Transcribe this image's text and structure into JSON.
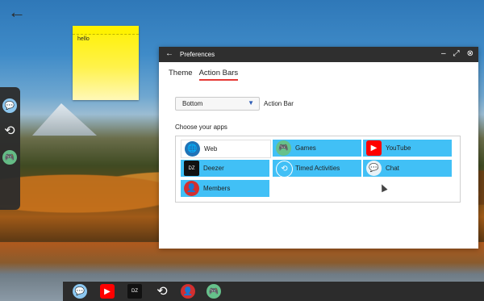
{
  "desktop": {
    "sticky_note_text": "hello",
    "left_dock": [
      {
        "name": "Chat",
        "icon": "chat-icon"
      },
      {
        "name": "Timed Activities",
        "icon": "history-clock-icon"
      },
      {
        "name": "Games",
        "icon": "gamepad-icon"
      }
    ],
    "bottom_dock": [
      {
        "name": "Chat",
        "icon": "chat-icon"
      },
      {
        "name": "YouTube",
        "icon": "youtube-icon"
      },
      {
        "name": "Deezer",
        "icon": "deezer-icon"
      },
      {
        "name": "Timed Activities",
        "icon": "history-clock-icon"
      },
      {
        "name": "Members",
        "icon": "user-icon"
      },
      {
        "name": "Games",
        "icon": "gamepad-icon"
      }
    ]
  },
  "window": {
    "title": "Preferences",
    "tabs": [
      "Theme",
      "Action Bars"
    ],
    "active_tab": "Action Bars",
    "action_bar_position": {
      "value": "Bottom",
      "label": "Action Bar"
    },
    "section_label": "Choose your apps",
    "apps": [
      {
        "label": "Web",
        "selected": false,
        "icon": "globe-icon"
      },
      {
        "label": "Games",
        "selected": true,
        "icon": "gamepad-icon"
      },
      {
        "label": "YouTube",
        "selected": true,
        "icon": "youtube-icon"
      },
      {
        "label": "Deezer",
        "selected": true,
        "icon": "deezer-icon"
      },
      {
        "label": "Timed Activities",
        "selected": true,
        "icon": "history-clock-icon"
      },
      {
        "label": "Chat",
        "selected": true,
        "icon": "chat-icon"
      },
      {
        "label": "Members",
        "selected": true,
        "icon": "user-icon"
      }
    ]
  },
  "colors": {
    "accent_tab_underline": "#e53935",
    "app_selected_bg": "#41c0f6",
    "titlebar_bg": "#2f2f2f",
    "dock_bg": "#2c2c2c"
  }
}
